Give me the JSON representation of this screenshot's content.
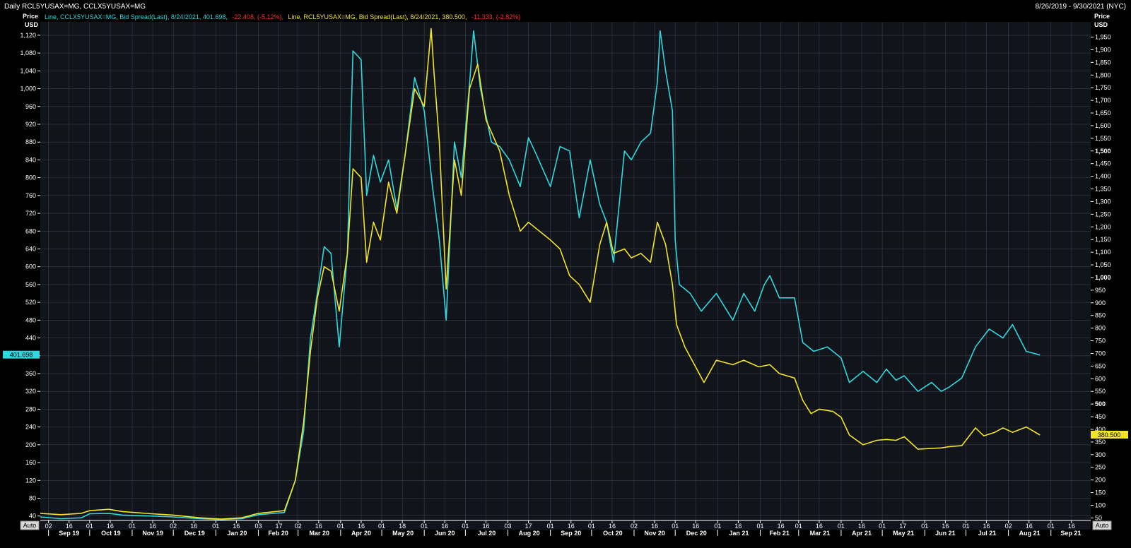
{
  "header": {
    "title": "Daily RCL5YUSAX=MG, CCLX5YUSAX=MG",
    "date_range": "8/26/2019 - 9/30/2021 (NYC)"
  },
  "legend": {
    "cyan": {
      "text": "Line, CCLX5YUSAX=MG, Bid Spread(Last), 8/24/2021, 401.698,",
      "change": "-22.408, (-5.12%),"
    },
    "yellow": {
      "text": "Line, RCL5YUSAX=MG, Bid Spread(Last), 8/24/2021, 380.500,",
      "change": "-11.333, (-2.82%)"
    }
  },
  "left_axis": {
    "label_line1": "Price",
    "label_line2": "USD",
    "last_value": "401.698",
    "auto": "Auto"
  },
  "right_axis": {
    "label_line1": "Price",
    "label_line2": "USD",
    "last_value": "380.500",
    "auto": "Auto"
  },
  "colors": {
    "cyan": "#2fd8de",
    "yellow": "#f2e428",
    "background": "#12141b",
    "grid": "#3a3d48",
    "negative": "#ff3030"
  },
  "chart_data": {
    "type": "line",
    "x_axis": {
      "day_ticks": [
        "02",
        "16",
        "01",
        "16",
        "01",
        "16",
        "02",
        "16",
        "01",
        "16",
        "03",
        "17",
        "02",
        "16",
        "01",
        "16",
        "01",
        "18",
        "01",
        "16",
        "01",
        "16",
        "03",
        "17",
        "01",
        "16",
        "01",
        "16",
        "02",
        "16",
        "01",
        "16",
        "01",
        "16",
        "01",
        "16",
        "01",
        "16",
        "01",
        "16",
        "01",
        "17",
        "01",
        "16",
        "01",
        "16",
        "02",
        "16",
        "01",
        "16"
      ],
      "months": [
        "Sep 19",
        "Oct 19",
        "Nov 19",
        "Dec 19",
        "Jan 20",
        "Feb 20",
        "Mar 20",
        "Apr 20",
        "May 20",
        "Jun 20",
        "Jul 20",
        "Aug 20",
        "Sep 20",
        "Oct 20",
        "Nov 20",
        "Dec 20",
        "Jan 21",
        "Feb 21",
        "Mar 21",
        "Apr 21",
        "May 21",
        "Jun 21",
        "Jul 21",
        "Aug 21",
        "Sep 21"
      ]
    },
    "y_left": {
      "min": 30,
      "max": 1150,
      "ticks": [
        40,
        80,
        120,
        160,
        200,
        240,
        280,
        320,
        360,
        400,
        440,
        480,
        520,
        560,
        600,
        640,
        680,
        720,
        760,
        800,
        840,
        880,
        920,
        960,
        1000,
        1040,
        1080,
        1120
      ]
    },
    "y_right": {
      "min": 40,
      "max": 2010,
      "ticks": [
        50,
        100,
        150,
        200,
        250,
        300,
        350,
        400,
        450,
        500,
        550,
        600,
        650,
        700,
        750,
        800,
        850,
        900,
        950,
        1000,
        1050,
        1100,
        1150,
        1200,
        1250,
        1300,
        1350,
        1400,
        1450,
        1500,
        1550,
        1600,
        1650,
        1700,
        1750,
        1800,
        1850,
        1900,
        1950
      ]
    },
    "grid": true,
    "series": [
      {
        "name": "CCLX5YUSAX=MG",
        "color": "#2fd8de",
        "axis": "left",
        "points": [
          [
            "2019-08-26",
            38
          ],
          [
            "2019-09-10",
            34
          ],
          [
            "2019-09-25",
            36
          ],
          [
            "2019-10-01",
            45
          ],
          [
            "2019-10-15",
            46
          ],
          [
            "2019-10-25",
            42
          ],
          [
            "2019-11-15",
            40
          ],
          [
            "2019-12-01",
            38
          ],
          [
            "2019-12-20",
            34
          ],
          [
            "2020-01-05",
            32
          ],
          [
            "2020-01-20",
            34
          ],
          [
            "2020-02-01",
            43
          ],
          [
            "2020-02-20",
            48
          ],
          [
            "2020-02-28",
            120
          ],
          [
            "2020-03-05",
            230
          ],
          [
            "2020-03-10",
            440
          ],
          [
            "2020-03-15",
            540
          ],
          [
            "2020-03-20",
            645
          ],
          [
            "2020-03-25",
            630
          ],
          [
            "2020-03-31",
            420
          ],
          [
            "2020-04-06",
            630
          ],
          [
            "2020-04-10",
            1085
          ],
          [
            "2020-04-16",
            1065
          ],
          [
            "2020-04-20",
            760
          ],
          [
            "2020-04-25",
            850
          ],
          [
            "2020-04-30",
            790
          ],
          [
            "2020-05-06",
            840
          ],
          [
            "2020-05-12",
            730
          ],
          [
            "2020-05-18",
            850
          ],
          [
            "2020-05-25",
            1025
          ],
          [
            "2020-06-01",
            950
          ],
          [
            "2020-06-07",
            780
          ],
          [
            "2020-06-12",
            660
          ],
          [
            "2020-06-17",
            480
          ],
          [
            "2020-06-23",
            880
          ],
          [
            "2020-06-28",
            800
          ],
          [
            "2020-07-04",
            1010
          ],
          [
            "2020-07-07",
            1130
          ],
          [
            "2020-07-12",
            1000
          ],
          [
            "2020-07-20",
            880
          ],
          [
            "2020-07-26",
            870
          ],
          [
            "2020-08-02",
            840
          ],
          [
            "2020-08-10",
            780
          ],
          [
            "2020-08-16",
            890
          ],
          [
            "2020-08-22",
            850
          ],
          [
            "2020-09-01",
            780
          ],
          [
            "2020-09-08",
            870
          ],
          [
            "2020-09-15",
            860
          ],
          [
            "2020-09-22",
            710
          ],
          [
            "2020-09-30",
            840
          ],
          [
            "2020-10-07",
            740
          ],
          [
            "2020-10-12",
            700
          ],
          [
            "2020-10-17",
            610
          ],
          [
            "2020-10-25",
            860
          ],
          [
            "2020-10-30",
            840
          ],
          [
            "2020-11-06",
            880
          ],
          [
            "2020-11-13",
            900
          ],
          [
            "2020-11-18",
            1015
          ],
          [
            "2020-11-20",
            1130
          ],
          [
            "2020-11-24",
            1040
          ],
          [
            "2020-11-29",
            950
          ],
          [
            "2020-12-01",
            660
          ],
          [
            "2020-12-04",
            560
          ],
          [
            "2020-12-12",
            540
          ],
          [
            "2020-12-20",
            500
          ],
          [
            "2020-12-31",
            540
          ],
          [
            "2021-01-12",
            480
          ],
          [
            "2021-01-20",
            540
          ],
          [
            "2021-01-28",
            500
          ],
          [
            "2021-02-04",
            560
          ],
          [
            "2021-02-08",
            580
          ],
          [
            "2021-02-15",
            530
          ],
          [
            "2021-02-26",
            530
          ],
          [
            "2021-03-04",
            430
          ],
          [
            "2021-03-12",
            410
          ],
          [
            "2021-03-22",
            420
          ],
          [
            "2021-04-01",
            395
          ],
          [
            "2021-04-07",
            340
          ],
          [
            "2021-04-17",
            365
          ],
          [
            "2021-04-27",
            340
          ],
          [
            "2021-05-04",
            370
          ],
          [
            "2021-05-11",
            345
          ],
          [
            "2021-05-17",
            355
          ],
          [
            "2021-05-27",
            320
          ],
          [
            "2021-06-06",
            340
          ],
          [
            "2021-06-13",
            320
          ],
          [
            "2021-06-19",
            330
          ],
          [
            "2021-06-28",
            350
          ],
          [
            "2021-07-08",
            420
          ],
          [
            "2021-07-18",
            460
          ],
          [
            "2021-07-28",
            440
          ],
          [
            "2021-08-04",
            470
          ],
          [
            "2021-08-14",
            410
          ],
          [
            "2021-08-24",
            401.698
          ]
        ]
      },
      {
        "name": "RCL5YUSAX=MG",
        "color": "#f2e428",
        "axis": "left",
        "points": [
          [
            "2019-08-26",
            46
          ],
          [
            "2019-09-10",
            43
          ],
          [
            "2019-09-25",
            46
          ],
          [
            "2019-10-01",
            52
          ],
          [
            "2019-10-15",
            55
          ],
          [
            "2019-10-25",
            50
          ],
          [
            "2019-11-15",
            45
          ],
          [
            "2019-12-01",
            42
          ],
          [
            "2019-12-20",
            36
          ],
          [
            "2020-01-05",
            33
          ],
          [
            "2020-01-20",
            36
          ],
          [
            "2020-02-01",
            46
          ],
          [
            "2020-02-20",
            52
          ],
          [
            "2020-02-28",
            120
          ],
          [
            "2020-03-05",
            250
          ],
          [
            "2020-03-10",
            410
          ],
          [
            "2020-03-15",
            530
          ],
          [
            "2020-03-20",
            600
          ],
          [
            "2020-03-25",
            590
          ],
          [
            "2020-03-31",
            500
          ],
          [
            "2020-04-06",
            630
          ],
          [
            "2020-04-10",
            820
          ],
          [
            "2020-04-16",
            800
          ],
          [
            "2020-04-20",
            610
          ],
          [
            "2020-04-25",
            700
          ],
          [
            "2020-04-30",
            660
          ],
          [
            "2020-05-06",
            790
          ],
          [
            "2020-05-12",
            720
          ],
          [
            "2020-05-18",
            850
          ],
          [
            "2020-05-25",
            1000
          ],
          [
            "2020-06-01",
            960
          ],
          [
            "2020-06-06",
            1135
          ],
          [
            "2020-06-08",
            1040
          ],
          [
            "2020-06-12",
            880
          ],
          [
            "2020-06-17",
            550
          ],
          [
            "2020-06-23",
            840
          ],
          [
            "2020-06-28",
            760
          ],
          [
            "2020-07-04",
            1000
          ],
          [
            "2020-07-10",
            1055
          ],
          [
            "2020-07-16",
            930
          ],
          [
            "2020-07-26",
            860
          ],
          [
            "2020-08-02",
            760
          ],
          [
            "2020-08-10",
            680
          ],
          [
            "2020-08-16",
            700
          ],
          [
            "2020-08-24",
            680
          ],
          [
            "2020-09-01",
            660
          ],
          [
            "2020-09-08",
            640
          ],
          [
            "2020-09-15",
            580
          ],
          [
            "2020-09-22",
            560
          ],
          [
            "2020-09-30",
            520
          ],
          [
            "2020-10-07",
            650
          ],
          [
            "2020-10-12",
            700
          ],
          [
            "2020-10-17",
            630
          ],
          [
            "2020-10-25",
            640
          ],
          [
            "2020-10-30",
            620
          ],
          [
            "2020-11-06",
            630
          ],
          [
            "2020-11-13",
            610
          ],
          [
            "2020-11-18",
            700
          ],
          [
            "2020-11-24",
            650
          ],
          [
            "2020-11-29",
            560
          ],
          [
            "2020-12-02",
            470
          ],
          [
            "2020-12-08",
            420
          ],
          [
            "2020-12-15",
            380
          ],
          [
            "2020-12-22",
            340
          ],
          [
            "2020-12-31",
            390
          ],
          [
            "2021-01-12",
            380
          ],
          [
            "2021-01-20",
            390
          ],
          [
            "2021-01-31",
            375
          ],
          [
            "2021-02-08",
            380
          ],
          [
            "2021-02-15",
            360
          ],
          [
            "2021-02-26",
            350
          ],
          [
            "2021-03-04",
            300
          ],
          [
            "2021-03-10",
            270
          ],
          [
            "2021-03-16",
            280
          ],
          [
            "2021-03-26",
            275
          ],
          [
            "2021-04-01",
            262
          ],
          [
            "2021-04-07",
            222
          ],
          [
            "2021-04-17",
            200
          ],
          [
            "2021-04-27",
            210
          ],
          [
            "2021-05-04",
            212
          ],
          [
            "2021-05-11",
            210
          ],
          [
            "2021-05-17",
            218
          ],
          [
            "2021-05-27",
            190
          ],
          [
            "2021-06-06",
            192
          ],
          [
            "2021-06-13",
            193
          ],
          [
            "2021-06-19",
            196
          ],
          [
            "2021-06-28",
            198
          ],
          [
            "2021-07-08",
            238
          ],
          [
            "2021-07-14",
            220
          ],
          [
            "2021-07-22",
            228
          ],
          [
            "2021-07-28",
            238
          ],
          [
            "2021-08-04",
            228
          ],
          [
            "2021-08-14",
            240
          ],
          [
            "2021-08-24",
            222
          ]
        ]
      }
    ]
  }
}
